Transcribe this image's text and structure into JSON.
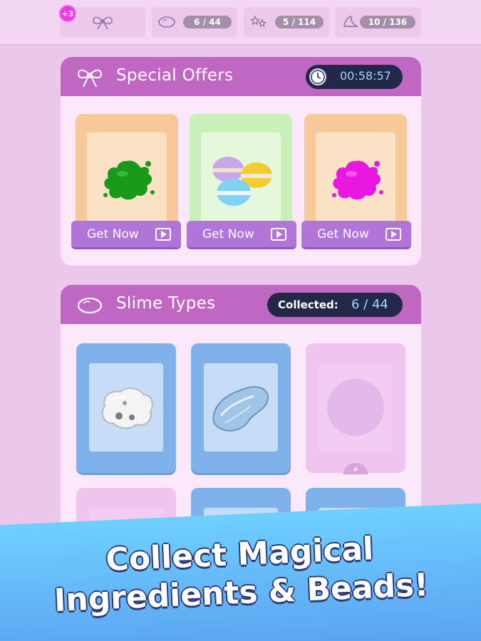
{
  "topbar": {
    "badge": "+3",
    "counters": [
      {
        "icon": "ribbon-bow-icon",
        "value": ""
      },
      {
        "icon": "slime-blob-icon",
        "value": "6 / 44"
      },
      {
        "icon": "sparkle-stars-icon",
        "value": "5 / 114"
      },
      {
        "icon": "shell-icon",
        "value": "10 / 136"
      }
    ]
  },
  "special_offers": {
    "title": "Special Offers",
    "timer": "00:58:57",
    "offers": [
      {
        "item": "green-slime-splat",
        "button": "Get Now",
        "card_color": "#f6c89a"
      },
      {
        "item": "macaron-beads",
        "button": "Get Now",
        "card_color": "#c8f0b8"
      },
      {
        "item": "magenta-slime-splat",
        "button": "Get Now",
        "card_color": "#f6c89a"
      }
    ]
  },
  "slime_types": {
    "title": "Slime Types",
    "collected_label": "Collected:",
    "collected_value": "6 / 44"
  },
  "banner": {
    "line1": "Collect Magical",
    "line2": "Ingredients & Beads!"
  },
  "colors": {
    "background": "#ecc7ec",
    "panel_header": "#c067c4",
    "button": "#b174d8",
    "pill_dark": "#242848",
    "card_blue": "#7fb2ea",
    "banner": "#5fb6f6"
  }
}
